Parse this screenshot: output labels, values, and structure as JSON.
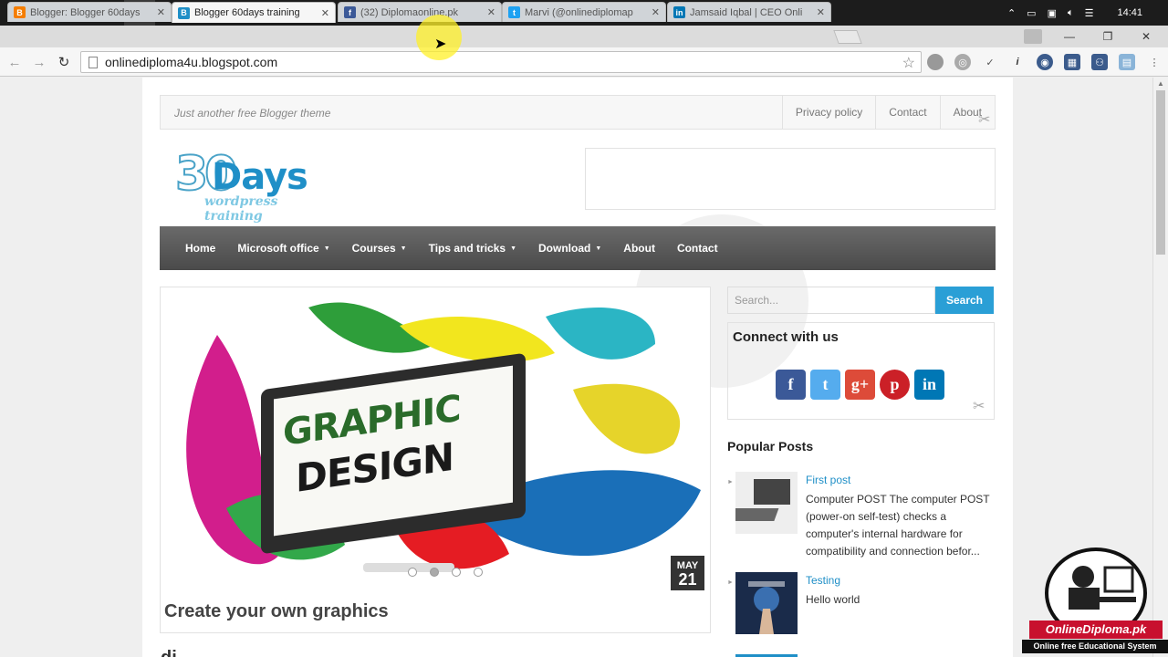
{
  "taskbar": {
    "clock": "14:41",
    "icons": [
      "windows-icon",
      "cortana-icon",
      "task-view-icon",
      "file-explorer-icon",
      "chrome-icon",
      "store-icon",
      "edge-icon",
      "app-icon",
      "app-icon",
      "app-icon",
      "skype-icon",
      "powerpoint-icon"
    ]
  },
  "tabs": [
    {
      "label": "Blogger: Blogger 60days",
      "icon": "blogger-icon",
      "color": "#f57d00"
    },
    {
      "label": "Blogger 60days training",
      "icon": "blogger-icon",
      "color": "#1f8fc7"
    },
    {
      "label": "(32) Diplomaonline.pk",
      "icon": "facebook-icon",
      "color": "#3b5998"
    },
    {
      "label": "Marvi (@onlinediplomap",
      "icon": "twitter-icon",
      "color": "#1da1f2"
    },
    {
      "label": "Jamsaid Iqbal | CEO Onli",
      "icon": "linkedin-icon",
      "color": "#0077b5"
    }
  ],
  "address_bar": {
    "url": "onlinediploma4u.blogspot.com"
  },
  "site": {
    "tagline": "Just another free Blogger theme",
    "top_links": [
      "Privacy policy",
      "Contact",
      "About"
    ],
    "logo": {
      "big": "30",
      "word": "Days",
      "sub": "wordpress training"
    },
    "nav": [
      {
        "label": "Home",
        "dropdown": false
      },
      {
        "label": "Microsoft office",
        "dropdown": true
      },
      {
        "label": "Courses",
        "dropdown": true
      },
      {
        "label": "Tips and tricks",
        "dropdown": true
      },
      {
        "label": "Download",
        "dropdown": true
      },
      {
        "label": "About",
        "dropdown": false
      },
      {
        "label": "Contact",
        "dropdown": false
      }
    ],
    "slider": {
      "screen_line1": "GRAPHIC",
      "screen_line2": "DESIGN",
      "date_month": "MAY",
      "date_day": "21",
      "title": "Create your own graphics",
      "active_dot": 2,
      "dot_count": 4
    },
    "below_heading": "di",
    "search": {
      "placeholder": "Search...",
      "button": "Search"
    },
    "connect": {
      "title": "Connect with us",
      "icons": [
        {
          "name": "facebook-icon",
          "glyph": "f",
          "color": "#3b5998"
        },
        {
          "name": "twitter-icon",
          "glyph": "t",
          "color": "#55acee"
        },
        {
          "name": "googleplus-icon",
          "glyph": "g+",
          "color": "#dd4b39"
        },
        {
          "name": "pinterest-icon",
          "glyph": "p",
          "color": "#cb2027"
        },
        {
          "name": "linkedin-icon",
          "glyph": "in",
          "color": "#0077b5"
        }
      ]
    },
    "popular_posts": {
      "heading": "Popular Posts",
      "posts": [
        {
          "title": "First post",
          "snippet": "Computer POST  The computer POST (power-on self-test) checks a computer's internal hardware for compatibility and connection befor..."
        },
        {
          "title": "Testing",
          "snippet": "Hello world"
        }
      ]
    }
  },
  "brand_overlay": {
    "name": "OnlineDiploma.pk",
    "tagline": "Online free Educational System"
  }
}
